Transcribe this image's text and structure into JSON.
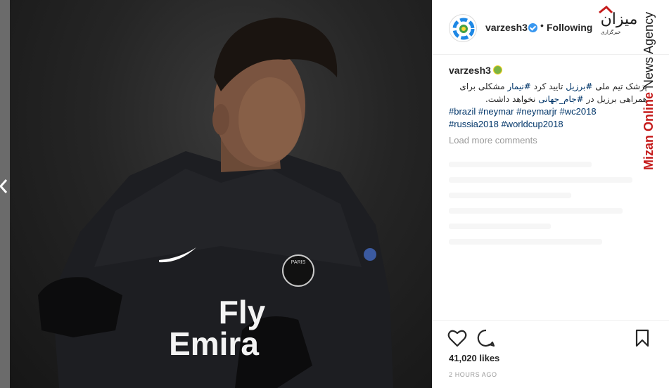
{
  "post": {
    "username": "varzesh3",
    "follow_state": "Following",
    "dot": "•",
    "caption": {
      "username": "varzesh3",
      "line1_parts": [
        "پزشک تیم ملی ",
        "#برزیل",
        " تایید کرد ",
        "#نیمار",
        " مشکلی برای"
      ],
      "line2_parts": [
        "همراهی برزیل در ",
        "#جام_جهانی",
        " نخواهد داشت."
      ],
      "hashtags": [
        "#brazil",
        "#neymar",
        "#neymarjr",
        "#wc2018",
        "#russia2018",
        "#worldcup2018"
      ]
    },
    "load_more": "Load more comments",
    "likes": "41,020 likes",
    "time": "2 HOURS AGO"
  },
  "photo": {
    "shirt_text_1": "Fly",
    "shirt_text_2": "Emira",
    "badge_text": "PARIS"
  },
  "watermark": {
    "logo_text": "میزان",
    "sub_text": "خبرگزاری",
    "vertical_bold": "Mizan Online",
    "vertical_rest": " News Agency"
  },
  "colors": {
    "link": "#003569",
    "verified": "#3897f0",
    "brand_red": "#c51b1b"
  },
  "icons": [
    "chevron-left-icon",
    "heart-icon",
    "comment-icon",
    "bookmark-icon",
    "verified-icon",
    "football-emoji-icon"
  ]
}
